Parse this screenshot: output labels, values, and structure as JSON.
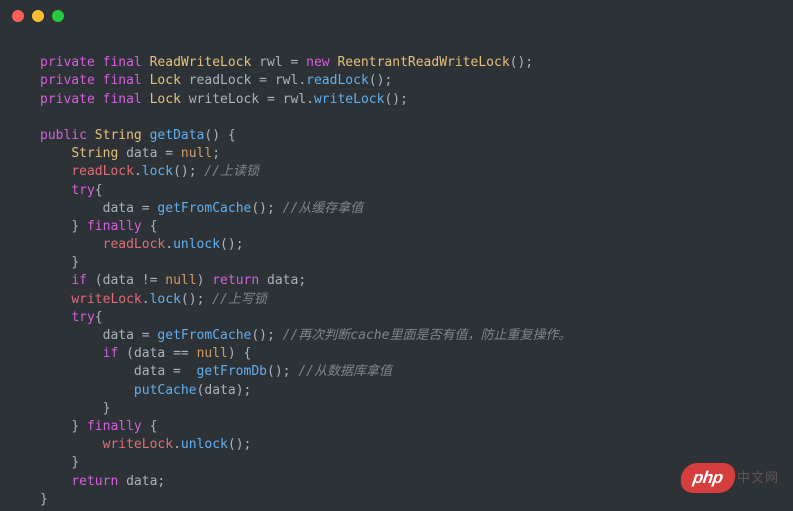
{
  "window": {
    "controls": [
      "close",
      "minimize",
      "zoom"
    ]
  },
  "code": {
    "t": {
      "private": "private",
      "final": "final",
      "public": "public",
      "new": "new",
      "try": "try",
      "finally": "finally",
      "if": "if",
      "return": "return",
      "null": "null",
      "ReadWriteLock": "ReadWriteLock",
      "ReentrantReadWriteLock": "ReentrantReadWriteLock",
      "Lock": "Lock",
      "String": "String",
      "rwl": "rwl",
      "readLock_f": "readLock",
      "writeLock_f": "writeLock",
      "data": "data",
      "getData": "getData",
      "readLock_m": "readLock",
      "writeLock_m": "writeLock",
      "lock": "lock",
      "unlock": "unlock",
      "getFromCache": "getFromCache",
      "getFromDb": "getFromDb",
      "putCache": "putCache",
      "eq": " = ",
      "eqeq": " == ",
      "neq": " != ",
      "semi": ";",
      "lp": "(",
      "rp": ")",
      "lb": "{",
      "rb": "}",
      "dot": ".",
      "comment_readlock": "//上读锁",
      "comment_fromcache": "//从缓存拿值",
      "comment_writelock": "//上写锁",
      "comment_recheck": "//再次判断cache里面是否有值，防止重复操作。",
      "comment_fromdb": "//从数据库拿值"
    }
  },
  "watermark": {
    "badge": "php",
    "text": "中文网"
  }
}
